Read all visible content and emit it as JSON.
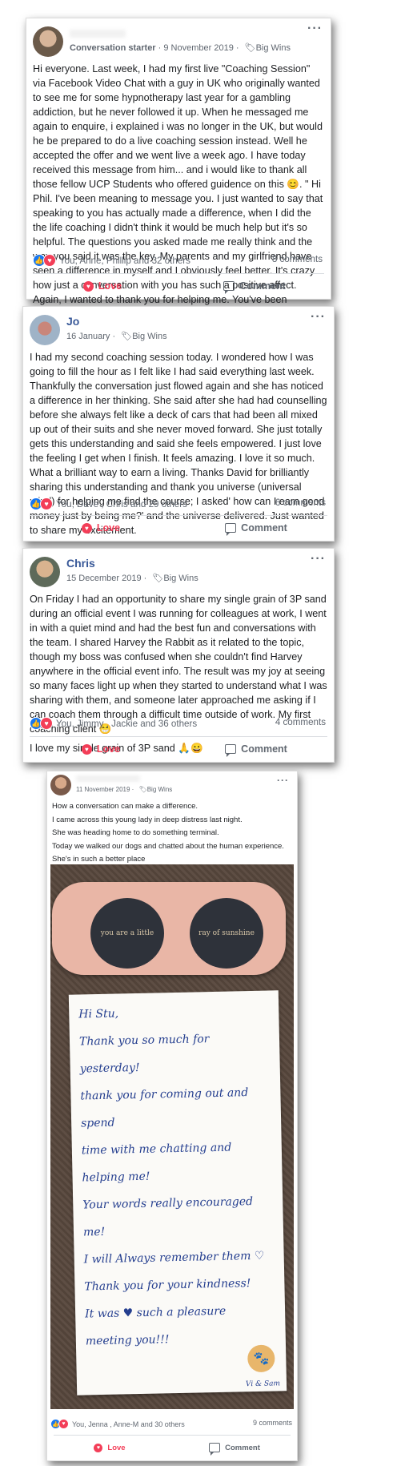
{
  "posts": [
    {
      "name": "",
      "role": "Conversation starter",
      "date": "9 November 2019",
      "tag": "Big Wins",
      "text": [
        "Hi everyone. Last week, I had my first live \"Coaching Session\" via Facebook Video Chat with a guy in UK who originally wanted to see me for some hypnotherapy last year for a gambling addiction, but he never followed it up. When he messaged me again to enquire, i explained i was no longer in the UK, but would he be prepared to do a live coaching session instead. Well he accepted the offer and we went live a week ago. I have today received this message from him... and i would like to thank all those fellow UCP Students who offered guidence on this 😊. \" Hi Phil. I've been meaning to message you. I just wanted to say that speaking to you has actually made a difference, when I did the the life coaching I didn't think it would be much help but it's so helpful. The questions you asked made me really think and the way you said it was the key. My parents and my girlfriend have seen a difference in myself and I obviously feel better. It's crazy how just a conversation with you has such a positive affect. Again, I wanted to thank you for helping me. You've been awesome. \""
      ],
      "reactors": "You, Anne, Phillip and 32 others",
      "comments": "8 comments",
      "love_label": "Love",
      "comment_label": "Comment"
    },
    {
      "name": "Jo",
      "date": "16 January",
      "tag": "Big Wins",
      "text": [
        "I had my second coaching session today. I wondered how I was going to fill the hour as I felt like I had said everything last week. Thankfully the conversation just flowed again and she has noticed a difference in her thinking. She said after she had had counselling before she always felt like a deck of cars that had been all mixed up out of their suits and she never moved forward. She just totally gets this understanding and said she feels empowered. I just love the feeling I get when I finish. It feels amazing. I love it so much. What a brilliant way to earn a living. Thanks David for brilliantly sharing this understanding and thank you universe (universal mind) for helping me find the course; I asked' how can I earn good money just by being me?' and the universe delivered. Just wanted to share my excitement."
      ],
      "reactors": "You, Dave , Chris  and 29 others",
      "comments": "6 comments",
      "love_label": "Love",
      "comment_label": "Comment"
    },
    {
      "name": "Chris",
      "date": "15 December 2019",
      "tag": "Big Wins",
      "text": [
        "On Friday I had an opportunity to share my single grain of 3P sand during an official event I was running for colleagues at work, I went in with a quiet mind and had the best fun and conversations with the team. I shared Harvey the Rabbit as it related to the topic, though my boss was confused when she couldn't find Harvey anywhere in the official event info. The result was my joy at seeing so many faces light up when they started to understand what I was sharing with them, and someone later approached me asking if I can coach them through a difficult time outside of work. My first coaching client 😁",
        "I love my single grain of 3P sand 🙏😀"
      ],
      "reactors": "You, Jimmy , Jackie  and 36 others",
      "comments": "4 comments",
      "love_label": "Love",
      "comment_label": "Comment"
    },
    {
      "name": "",
      "date": "11 November 2019",
      "tag": "Big Wins",
      "text": [
        "How a conversation can make a difference.",
        "I came across this young lady in deep distress last night.",
        "She was heading home to do something terminal.",
        "Today we walked our dogs and chatted about the human experience.",
        "She's in such a better place"
      ],
      "photo": {
        "lens_left": "you are a little",
        "lens_right": "ray of sunshine",
        "note": "Hi Stu,\nThank you so much for yesterday!\nthank you for coming out and spend\ntime with me chatting and helping me!\nYour words really encouraged me!\nI will Always remember them ♡\nThank you for your kindness!\nIt was ♥ such a pleasure\nmeeting you!!!",
        "signature": "Vi & Sam"
      },
      "reactors": "You, Jenna , Anne-M and 30 others",
      "comments": "9 comments",
      "love_label": "Love",
      "comment_label": "Comment"
    }
  ],
  "icons": {
    "like": "thumbs-up-icon",
    "love": "heart-icon",
    "tag": "tag-icon",
    "comment": "speech-bubble-icon",
    "more": "ellipsis-icon"
  },
  "colors": {
    "link": "#385898",
    "love": "#f33e58",
    "like": "#1877f2"
  }
}
